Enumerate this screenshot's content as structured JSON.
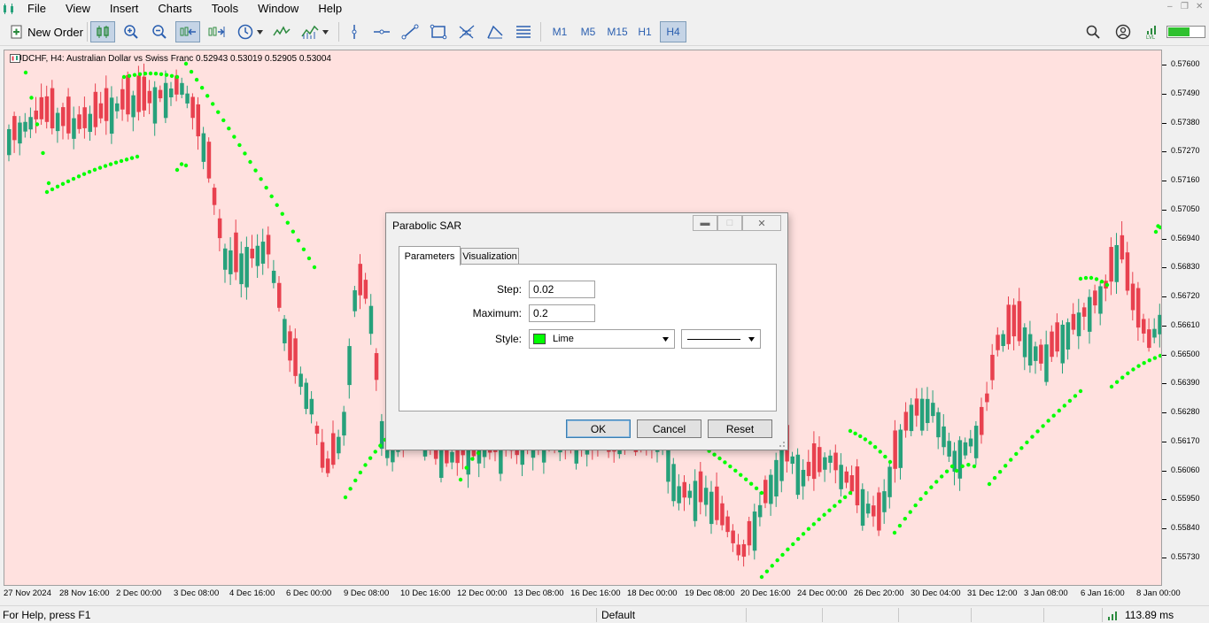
{
  "menu": {
    "items": [
      "File",
      "View",
      "Insert",
      "Charts",
      "Tools",
      "Window",
      "Help"
    ]
  },
  "toolbar": {
    "new_order_label": "New Order",
    "timeframes": [
      "M1",
      "M5",
      "M15",
      "H1",
      "H4"
    ],
    "active_timeframe": "H4"
  },
  "chart": {
    "title": "AUDCHF, H4:  Australian Dollar vs Swiss Franc  0.52943 0.53019 0.52905 0.53004",
    "background": "#ffe1df",
    "bull_color": "#26a17b",
    "bear_color": "#e8414f",
    "sar_color": "#00ff00",
    "price_labels": [
      "0.57600",
      "0.57490",
      "0.57380",
      "0.57270",
      "0.57160",
      "0.57050",
      "0.56940",
      "0.56830",
      "0.56720",
      "0.56610",
      "0.56500",
      "0.56390",
      "0.56280",
      "0.56170",
      "0.56060",
      "0.55950",
      "0.55840",
      "0.55730"
    ],
    "time_labels": [
      "27 Nov 2024",
      "28 Nov 16:00",
      "2 Dec 00:00",
      "3 Dec 08:00",
      "4 Dec 16:00",
      "6 Dec 00:00",
      "9 Dec 08:00",
      "10 Dec 16:00",
      "12 Dec 00:00",
      "13 Dec 08:00",
      "16 Dec 16:00",
      "18 Dec 00:00",
      "19 Dec 08:00",
      "20 Dec 16:00",
      "24 Dec 00:00",
      "26 Dec 20:00",
      "30 Dec 04:00",
      "31 Dec 12:00",
      "3 Jan 08:00",
      "6 Jan 16:00",
      "8 Jan 00:00"
    ]
  },
  "status": {
    "help": "For Help, press F1",
    "profile": "Default",
    "ping": "113.89 ms"
  },
  "dialog": {
    "title": "Parabolic SAR",
    "tabs": [
      "Parameters",
      "Visualization"
    ],
    "step_label": "Step:",
    "step_value": "0.02",
    "maximum_label": "Maximum:",
    "maximum_value": "0.2",
    "style_label": "Style:",
    "style_color_name": "Lime",
    "style_color": "#00ff00",
    "ok_label": "OK",
    "cancel_label": "Cancel",
    "reset_label": "Reset"
  }
}
